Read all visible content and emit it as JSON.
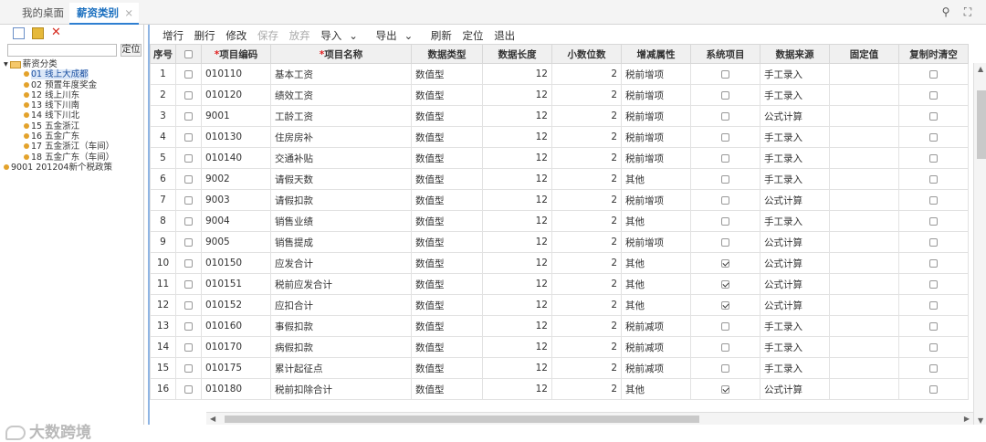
{
  "tabs": {
    "home": "我的桌面",
    "active": "薪资类别",
    "close": "×"
  },
  "left": {
    "search_button": "定位",
    "root": "薪资分类",
    "items": [
      "01 线上大成都",
      "02 预置年度奖金",
      "12 线上川东",
      "13 线下川南",
      "14 线下川北",
      "15 五金浙江",
      "16 五金广东",
      "17 五金浙江（车间）",
      "18 五金广东（车间）",
      "9001 201204新个税政策"
    ]
  },
  "toolbar": {
    "add": "增行",
    "del": "删行",
    "edit": "修改",
    "save": "保存",
    "cancel": "放弃",
    "import": "导入",
    "export": "导出",
    "refresh": "刷新",
    "locate": "定位",
    "exit": "退出"
  },
  "columns": {
    "seq": "序号",
    "code": "项目编码",
    "name": "项目名称",
    "dtype": "数据类型",
    "len": "数据长度",
    "dec": "小数位数",
    "attr": "增减属性",
    "sys": "系统项目",
    "src": "数据来源",
    "fixed": "固定值",
    "clear": "复制时清空"
  },
  "rows": [
    {
      "seq": "1",
      "code": "010110",
      "name": "基本工资",
      "dtype": "数值型",
      "len": "12",
      "dec": "2",
      "attr": "税前增项",
      "sys": false,
      "src": "手工录入"
    },
    {
      "seq": "2",
      "code": "010120",
      "name": "绩效工资",
      "dtype": "数值型",
      "len": "12",
      "dec": "2",
      "attr": "税前增项",
      "sys": false,
      "src": "手工录入"
    },
    {
      "seq": "3",
      "code": "9001",
      "name": "工龄工资",
      "dtype": "数值型",
      "len": "12",
      "dec": "2",
      "attr": "税前增项",
      "sys": false,
      "src": "公式计算"
    },
    {
      "seq": "4",
      "code": "010130",
      "name": "住房房补",
      "dtype": "数值型",
      "len": "12",
      "dec": "2",
      "attr": "税前增项",
      "sys": false,
      "src": "手工录入"
    },
    {
      "seq": "5",
      "code": "010140",
      "name": "交通补贴",
      "dtype": "数值型",
      "len": "12",
      "dec": "2",
      "attr": "税前增项",
      "sys": false,
      "src": "手工录入"
    },
    {
      "seq": "6",
      "code": "9002",
      "name": "请假天数",
      "dtype": "数值型",
      "len": "12",
      "dec": "2",
      "attr": "其他",
      "sys": false,
      "src": "手工录入"
    },
    {
      "seq": "7",
      "code": "9003",
      "name": "请假扣款",
      "dtype": "数值型",
      "len": "12",
      "dec": "2",
      "attr": "税前增项",
      "sys": false,
      "src": "公式计算"
    },
    {
      "seq": "8",
      "code": "9004",
      "name": "销售业绩",
      "dtype": "数值型",
      "len": "12",
      "dec": "2",
      "attr": "其他",
      "sys": false,
      "src": "手工录入"
    },
    {
      "seq": "9",
      "code": "9005",
      "name": "销售提成",
      "dtype": "数值型",
      "len": "12",
      "dec": "2",
      "attr": "税前增项",
      "sys": false,
      "src": "公式计算"
    },
    {
      "seq": "10",
      "code": "010150",
      "name": "应发合计",
      "dtype": "数值型",
      "len": "12",
      "dec": "2",
      "attr": "其他",
      "sys": true,
      "src": "公式计算"
    },
    {
      "seq": "11",
      "code": "010151",
      "name": "税前应发合计",
      "dtype": "数值型",
      "len": "12",
      "dec": "2",
      "attr": "其他",
      "sys": true,
      "src": "公式计算"
    },
    {
      "seq": "12",
      "code": "010152",
      "name": "应扣合计",
      "dtype": "数值型",
      "len": "12",
      "dec": "2",
      "attr": "其他",
      "sys": true,
      "src": "公式计算"
    },
    {
      "seq": "13",
      "code": "010160",
      "name": "事假扣款",
      "dtype": "数值型",
      "len": "12",
      "dec": "2",
      "attr": "税前减项",
      "sys": false,
      "src": "手工录入"
    },
    {
      "seq": "14",
      "code": "010170",
      "name": "病假扣款",
      "dtype": "数值型",
      "len": "12",
      "dec": "2",
      "attr": "税前减项",
      "sys": false,
      "src": "手工录入"
    },
    {
      "seq": "15",
      "code": "010175",
      "name": "累计起征点",
      "dtype": "数值型",
      "len": "12",
      "dec": "2",
      "attr": "税前减项",
      "sys": false,
      "src": "手工录入"
    },
    {
      "seq": "16",
      "code": "010180",
      "name": "税前扣除合计",
      "dtype": "数值型",
      "len": "12",
      "dec": "2",
      "attr": "其他",
      "sys": true,
      "src": "公式计算"
    }
  ],
  "watermark": "大数跨境"
}
